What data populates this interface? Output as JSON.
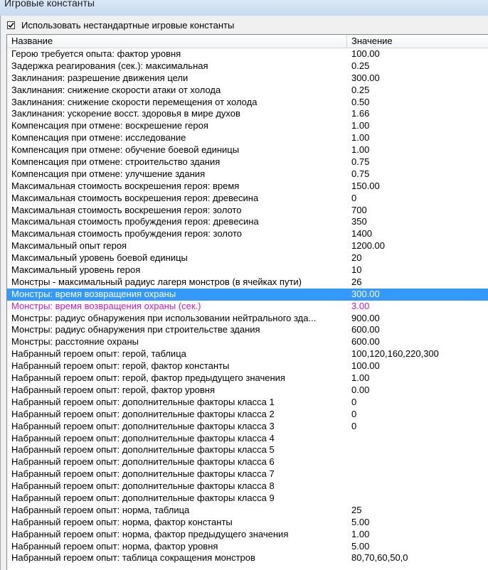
{
  "window": {
    "title": "Игровые константы"
  },
  "checkbox": {
    "label": "Использовать нестандартные игровые константы",
    "checked": true
  },
  "table": {
    "columns": {
      "name": "Название",
      "value": "Значение"
    },
    "rows": [
      {
        "name": "Герою требуется опыта: фактор уровня",
        "value": "100.00"
      },
      {
        "name": "Задержка реагирования (сек.): максимальная",
        "value": "0.25"
      },
      {
        "name": "Заклинания: разрешение движения цели",
        "value": "300.00"
      },
      {
        "name": "Заклинания: снижение скорости атаки от холода",
        "value": "0.25"
      },
      {
        "name": "Заклинания: снижение скорости перемещения от холода",
        "value": "0.50"
      },
      {
        "name": "Заклинания: ускорение восст. здоровья в мире духов",
        "value": "1.66"
      },
      {
        "name": "Компенсация при отмене: воскрешение героя",
        "value": "1.00"
      },
      {
        "name": "Компенсация при отмене: исследование",
        "value": "1.00"
      },
      {
        "name": "Компенсация при отмене: обучение боевой единицы",
        "value": "1.00"
      },
      {
        "name": "Компенсация при отмене: строительство здания",
        "value": "0.75"
      },
      {
        "name": "Компенсация при отмене: улучшение здания",
        "value": "0.75"
      },
      {
        "name": "Максимальная стоимость воскрешения героя: время",
        "value": "150.00"
      },
      {
        "name": "Максимальная стоимость воскрешения героя: древесина",
        "value": "0"
      },
      {
        "name": "Максимальная стоимость воскрешения героя: золото",
        "value": "700"
      },
      {
        "name": "Максимальная стоимость пробуждения героя: древесина",
        "value": "350"
      },
      {
        "name": "Максимальная стоимость пробуждения героя: золото",
        "value": "1400"
      },
      {
        "name": "Максимальный опыт героя",
        "value": "1200.00"
      },
      {
        "name": "Максимальный уровень боевой единицы",
        "value": "20"
      },
      {
        "name": "Максимальный уровень героя",
        "value": "10"
      },
      {
        "name": "Монстры - максимальный радиус лагеря монстров (в ячейках пути)",
        "value": "26"
      },
      {
        "name": "Монстры: время возвращения охраны",
        "value": "300.00",
        "state": "selected"
      },
      {
        "name": "Монстры: время возвращения охраны (сек.)",
        "value": "3.00",
        "state": "modified"
      },
      {
        "name": "Монстры: радиус обнаружения при использовании нейтрального зда...",
        "value": "900.00"
      },
      {
        "name": "Монстры: радиус обнаружения при строительстве здания",
        "value": "600.00"
      },
      {
        "name": "Монстры: расстояние охраны",
        "value": "600.00"
      },
      {
        "name": "Набранный героем опыт: герой, таблица",
        "value": "100,120,160,220,300"
      },
      {
        "name": "Набранный героем опыт: герой, фактор константы",
        "value": "100.00"
      },
      {
        "name": "Набранный героем опыт: герой, фактор предыдущего значения",
        "value": "1.00"
      },
      {
        "name": "Набранный героем опыт: герой, фактор уровня",
        "value": "0.00"
      },
      {
        "name": "Набранный героем опыт: дополнительные факторы класса 1",
        "value": "0"
      },
      {
        "name": "Набранный героем опыт: дополнительные факторы класса 2",
        "value": "0"
      },
      {
        "name": "Набранный героем опыт: дополнительные факторы класса 3",
        "value": "0"
      },
      {
        "name": "Набранный героем опыт: дополнительные факторы класса 4",
        "value": ""
      },
      {
        "name": "Набранный героем опыт: дополнительные факторы класса 5",
        "value": ""
      },
      {
        "name": "Набранный героем опыт: дополнительные факторы класса 6",
        "value": ""
      },
      {
        "name": "Набранный героем опыт: дополнительные факторы класса 7",
        "value": ""
      },
      {
        "name": "Набранный героем опыт: дополнительные факторы класса 8",
        "value": ""
      },
      {
        "name": "Набранный героем опыт: дополнительные факторы класса 9",
        "value": ""
      },
      {
        "name": "Набранный героем опыт: норма, таблица",
        "value": "25"
      },
      {
        "name": "Набранный героем опыт: норма, фактор константы",
        "value": "5.00"
      },
      {
        "name": "Набранный героем опыт: норма, фактор предыдущего значения",
        "value": "1.00"
      },
      {
        "name": "Набранный героем опыт: норма, фактор уровня",
        "value": "5.00"
      },
      {
        "name": "Набранный героем опыт: таблица сокращения монстров",
        "value": "80,70,60,50,0"
      }
    ]
  }
}
